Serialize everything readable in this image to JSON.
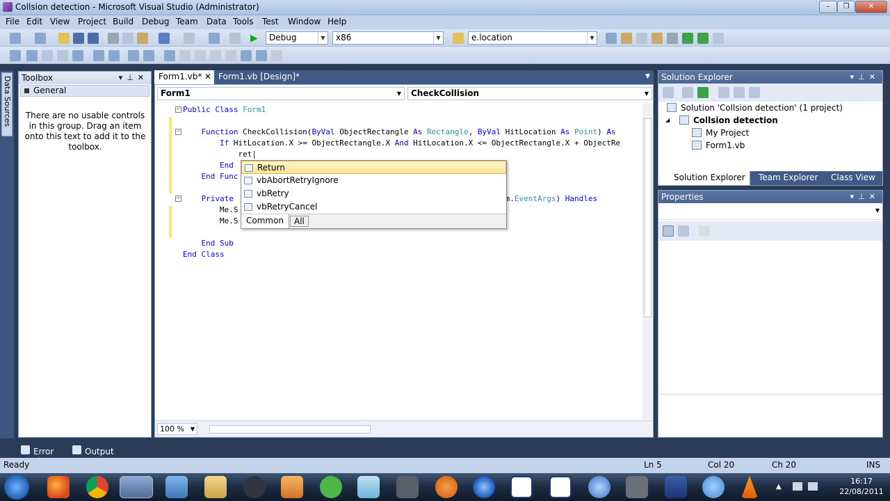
{
  "window": {
    "title": "Collsion detection - Microsoft Visual Studio (Administrator)",
    "buttons": [
      "–",
      "❐",
      "✕"
    ]
  },
  "menu": [
    "File",
    "Edit",
    "View",
    "Project",
    "Build",
    "Debug",
    "Team",
    "Data",
    "Tools",
    "Test",
    "Window",
    "Help"
  ],
  "toolbar": {
    "config": "Debug",
    "platform": "x86",
    "find": "e.location"
  },
  "left_strip": {
    "label": "Data Sources"
  },
  "toolbox": {
    "title": "Toolbox",
    "group": "General",
    "empty_message": "There are no usable controls in this group. Drag an item onto this text to add it to the toolbox."
  },
  "tabs": {
    "active": "Form1.vb*",
    "other": "Form1.vb [Design]*"
  },
  "nav": {
    "left": "Form1",
    "right": "CheckCollision"
  },
  "code": [
    {
      "parts": [
        {
          "t": "Public Class ",
          "c": "kw"
        },
        {
          "t": "Form1",
          "c": "ty"
        }
      ]
    },
    {
      "parts": []
    },
    {
      "parts": [
        {
          "t": "    Function ",
          "c": "kw"
        },
        {
          "t": "CheckCollision(",
          "c": ""
        },
        {
          "t": "ByVal ",
          "c": "kw"
        },
        {
          "t": "ObjectRectangle ",
          "c": ""
        },
        {
          "t": "As ",
          "c": "kw"
        },
        {
          "t": "Rectangle",
          "c": "ty"
        },
        {
          "t": ", ",
          "c": ""
        },
        {
          "t": "ByVal ",
          "c": "kw"
        },
        {
          "t": "HitLocation ",
          "c": ""
        },
        {
          "t": "As ",
          "c": "kw"
        },
        {
          "t": "Point",
          "c": "ty"
        },
        {
          "t": ") ",
          "c": ""
        },
        {
          "t": "As",
          "c": "kw"
        }
      ]
    },
    {
      "parts": [
        {
          "t": "        If ",
          "c": "kw"
        },
        {
          "t": "HitLocation.X >= ObjectRectangle.X ",
          "c": ""
        },
        {
          "t": "And ",
          "c": "kw"
        },
        {
          "t": "HitLocation.X <= ObjectRectangle.X + ObjectRe",
          "c": ""
        }
      ]
    },
    {
      "parts": [
        {
          "t": "            ret|",
          "c": ""
        }
      ]
    },
    {
      "parts": [
        {
          "t": "        End ",
          "c": "kw"
        }
      ]
    },
    {
      "parts": [
        {
          "t": "    End Func",
          "c": "kw"
        }
      ]
    },
    {
      "parts": []
    },
    {
      "parts": [
        {
          "t": "    Private ",
          "c": "kw"
        },
        {
          "t": "                                                  ",
          "c": ""
        },
        {
          "t": "As ",
          "c": "kw"
        },
        {
          "t": "System.",
          "c": ""
        },
        {
          "t": "EventArgs",
          "c": "ty"
        },
        {
          "t": ") ",
          "c": ""
        },
        {
          "t": "Handles",
          "c": "kw"
        }
      ]
    },
    {
      "parts": [
        {
          "t": "        Me.S",
          "c": ""
        }
      ]
    },
    {
      "parts": [
        {
          "t": "        Me.S",
          "c": ""
        }
      ]
    },
    {
      "parts": []
    },
    {
      "parts": [
        {
          "t": "    End Sub",
          "c": "kw"
        }
      ]
    },
    {
      "parts": [
        {
          "t": "End Class",
          "c": "kw"
        }
      ]
    }
  ],
  "zoom": "100 %",
  "intellisense": {
    "items": [
      "Return",
      "vbAbortRetryIgnore",
      "vbRetry",
      "vbRetryCancel"
    ],
    "tabs": [
      "Common",
      "All"
    ]
  },
  "solution_explorer": {
    "title": "Solution Explorer",
    "solution": "Solution 'Collsion detection' (1 project)",
    "project": "Collsion detection",
    "items": [
      "My Project",
      "Form1.vb"
    ],
    "tabs": [
      "Solution Explorer",
      "Team Explorer",
      "Class View"
    ]
  },
  "properties": {
    "title": "Properties"
  },
  "bottom_tabs": [
    "Error List",
    "Output"
  ],
  "status": {
    "ready": "Ready",
    "ln": "Ln 5",
    "col": "Col 20",
    "ch": "Ch 20",
    "ins": "INS"
  },
  "clock": {
    "time": "16:17",
    "date": "22/08/2011"
  },
  "colors": {
    "accent": "#405a85",
    "keyword": "#0000ff",
    "type": "#2b91af",
    "highlight": "#fbe49a"
  }
}
